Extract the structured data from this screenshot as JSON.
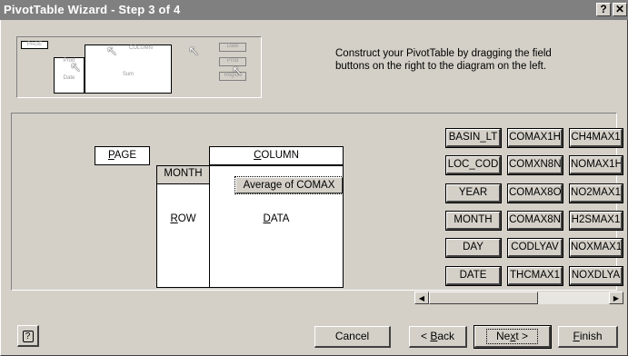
{
  "window": {
    "title": "PivotTable Wizard - Step 3 of 4",
    "help_label": "?",
    "close_label": "✕"
  },
  "illustration": {
    "page_label": "PAGE",
    "column_label": "COLUMN",
    "row_label": "Prod",
    "data_label": "Sum",
    "field_left": "Date",
    "field_buttons": [
      "Date",
      "Prod",
      "Region"
    ]
  },
  "instructions": "Construct your PivotTable by dragging the field buttons on the right to the diagram on the left.",
  "layout": {
    "page": {
      "prefix": "",
      "key": "P",
      "rest": "AGE"
    },
    "column": {
      "prefix": "",
      "key": "C",
      "rest": "OLUMN"
    },
    "row": {
      "prefix": "",
      "key": "R",
      "rest": "OW"
    },
    "data": {
      "prefix": "",
      "key": "D",
      "rest": "ATA"
    },
    "row_field": "MONTH",
    "data_field": "Average of COMAX"
  },
  "fields": {
    "col1": [
      "BASIN_LT",
      "LOC_COD",
      "YEAR",
      "MONTH",
      "DAY",
      "DATE"
    ],
    "col2": [
      "COMAX1H",
      "COMXN8N",
      "COMAX8O",
      "COMAX8N",
      "CODLYAV",
      "THCMAX1"
    ],
    "col3": [
      "CH4MAX1",
      "NOMAX1H",
      "NO2MAX1",
      "H2SMAX1",
      "NOXMAX1",
      "NOXDLYA"
    ]
  },
  "scrollbar": {
    "left_arrow": "◀",
    "right_arrow": "▶"
  },
  "buttons": {
    "help": "?",
    "cancel": "Cancel",
    "back": {
      "prefix": "< ",
      "key": "B",
      "rest": "ack"
    },
    "next": {
      "prefix": "Ne",
      "key": "x",
      "rest": "t >"
    },
    "finish": {
      "prefix": "",
      "key": "F",
      "rest": "inish"
    }
  }
}
